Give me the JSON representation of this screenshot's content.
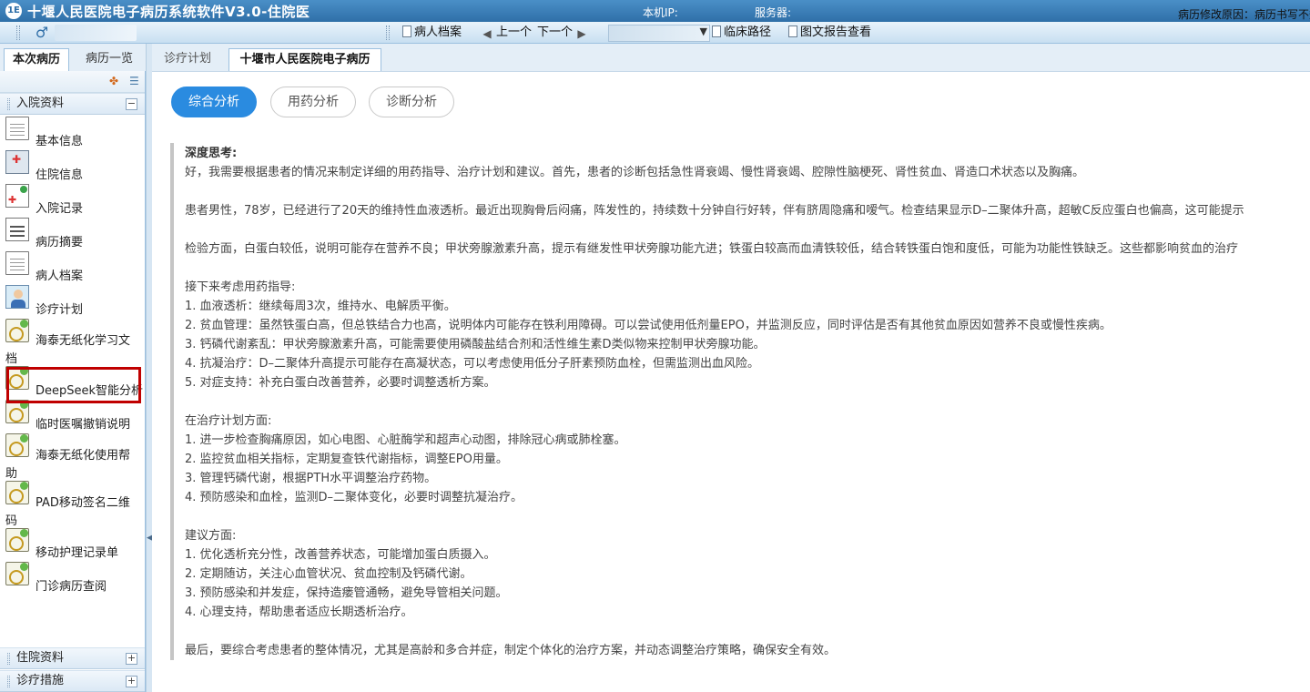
{
  "titlebar": {
    "logo_text": "1E",
    "title": "十堰人民医院电子病历系统软件V3.0-住院医",
    "ip_label": "本机IP:",
    "server_label": "服务器:",
    "modify_reason": "病历修改原因：病历书写不规范"
  },
  "toolbar": {
    "patient_file": "病人档案",
    "prev": "上一个",
    "next": "下一个",
    "clinical_path": "临床路径",
    "report_view": "图文报告查看"
  },
  "left_tabs": [
    "本次病历",
    "病历一览"
  ],
  "sections": {
    "admission": "入院资料",
    "inpatient": "住院资料",
    "treatment": "诊疗措施",
    "collapse_symbol": "−",
    "expand_symbol": "+"
  },
  "nav_items": [
    {
      "label": "基本信息",
      "icon": "document-icon"
    },
    {
      "label": "住院信息",
      "icon": "hospital-icon"
    },
    {
      "label": "入院记录",
      "icon": "record-icon"
    },
    {
      "label": "病历摘要",
      "icon": "summary-icon"
    },
    {
      "label": "病人档案",
      "icon": "document-icon"
    },
    {
      "label": "诊疗计划",
      "icon": "doctor-icon"
    },
    {
      "label": "海泰无纸化学习文",
      "label2": "档",
      "icon": "note-icon"
    },
    {
      "label": "DeepSeek智能分析",
      "icon": "note-icon"
    },
    {
      "label": "临时医嘱撤销说明",
      "icon": "note-icon"
    },
    {
      "label": "海泰无纸化使用帮",
      "label2": "助",
      "icon": "note-icon"
    },
    {
      "label": "PAD移动签名二维",
      "label2": "码",
      "icon": "note-icon"
    },
    {
      "label": "移动护理记录单",
      "icon": "note-icon"
    },
    {
      "label": "门诊病历查阅",
      "icon": "note-icon"
    }
  ],
  "main_tabs": [
    "诊疗计划",
    "十堰市人民医院电子病历"
  ],
  "analysis_tabs": [
    "综合分析",
    "用药分析",
    "诊断分析"
  ],
  "content": [
    {
      "text": "深度思考:",
      "bold": true
    },
    {
      "text": "好，我需要根据患者的情况来制定详细的用药指导、治疗计划和建议。首先，患者的诊断包括急性肾衰竭、慢性肾衰竭、腔隙性脑梗死、肾性贫血、肾造口术状态以及胸痛。"
    },
    {
      "text": ""
    },
    {
      "text": "患者男性，78岁，已经进行了20天的维持性血液透析。最近出现胸骨后闷痛，阵发性的，持续数十分钟自行好转，伴有脐周隐痛和嗳气。检查结果显示D–二聚体升高，超敏C反应蛋白也偏高，这可能提示"
    },
    {
      "text": ""
    },
    {
      "text": "检验方面，白蛋白较低，说明可能存在营养不良；甲状旁腺激素升高，提示有继发性甲状旁腺功能亢进；铁蛋白较高而血清铁较低，结合转铁蛋白饱和度低，可能为功能性铁缺乏。这些都影响贫血的治疗"
    },
    {
      "text": ""
    },
    {
      "text": "接下来考虑用药指导:"
    },
    {
      "text": "1. 血液透析：继续每周3次，维持水、电解质平衡。"
    },
    {
      "text": "2. 贫血管理：虽然铁蛋白高，但总铁结合力也高，说明体内可能存在铁利用障碍。可以尝试使用低剂量EPO，并监测反应，同时评估是否有其他贫血原因如营养不良或慢性疾病。"
    },
    {
      "text": "3. 钙磷代谢紊乱：甲状旁腺激素升高，可能需要使用磷酸盐结合剂和活性维生素D类似物来控制甲状旁腺功能。"
    },
    {
      "text": "4. 抗凝治疗：D–二聚体升高提示可能存在高凝状态，可以考虑使用低分子肝素预防血栓，但需监测出血风险。"
    },
    {
      "text": "5. 对症支持：补充白蛋白改善营养，必要时调整透析方案。"
    },
    {
      "text": ""
    },
    {
      "text": "在治疗计划方面:"
    },
    {
      "text": "1. 进一步检查胸痛原因，如心电图、心脏酶学和超声心动图，排除冠心病或肺栓塞。"
    },
    {
      "text": "2. 监控贫血相关指标，定期复查铁代谢指标，调整EPO用量。"
    },
    {
      "text": "3. 管理钙磷代谢，根据PTH水平调整治疗药物。"
    },
    {
      "text": "4. 预防感染和血栓，监测D–二聚体变化，必要时调整抗凝治疗。"
    },
    {
      "text": ""
    },
    {
      "text": "建议方面:"
    },
    {
      "text": "1. 优化透析充分性，改善营养状态，可能增加蛋白质摄入。"
    },
    {
      "text": "2. 定期随访，关注心血管状况、贫血控制及钙磷代谢。"
    },
    {
      "text": "3. 预防感染和并发症，保持造瘘管通畅，避免导管相关问题。"
    },
    {
      "text": "4. 心理支持，帮助患者适应长期透析治疗。"
    },
    {
      "text": ""
    },
    {
      "text": "最后，要综合考虑患者的整体情况，尤其是高龄和多合并症，制定个体化的治疗方案，并动态调整治疗策略，确保安全有效。"
    }
  ]
}
